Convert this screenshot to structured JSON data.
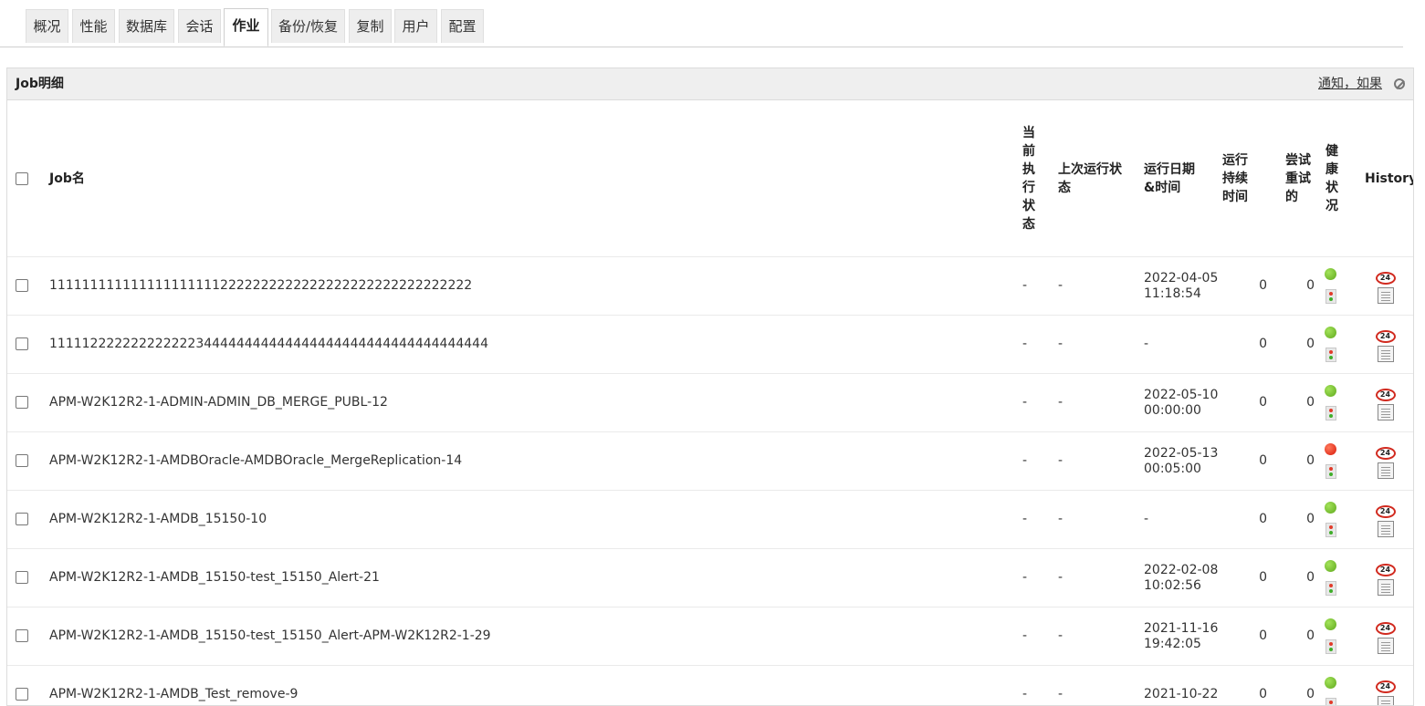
{
  "tabs": [
    {
      "label": "概况"
    },
    {
      "label": "性能"
    },
    {
      "label": "数据库"
    },
    {
      "label": "会话"
    },
    {
      "label": "作业",
      "active": true
    },
    {
      "label": "备份/恢复"
    },
    {
      "label": "复制"
    },
    {
      "label": "用户"
    },
    {
      "label": "配置"
    }
  ],
  "panel": {
    "title": "Job明细",
    "notify_link": "通知，如果",
    "hide_icon": "circle-slash-icon"
  },
  "table": {
    "headers": {
      "job_name": "Job名",
      "current_status": "当前执行状态",
      "last_run_status": "上次运行状态",
      "run_datetime": "运行日期&时间",
      "run_duration": "运行持续时间",
      "retries": "尝试重试的",
      "health": "健康状况",
      "history": "History"
    },
    "rows": [
      {
        "name": "1111111111111111111112222222222222222222222222222222",
        "current": "-",
        "last": "-",
        "date": "2022-04-05",
        "time": "11:18:54",
        "duration": "0",
        "retries": "0",
        "health": "green"
      },
      {
        "name": "111112222222222222344444444444444444444444444444444444",
        "current": "-",
        "last": "-",
        "date": "-",
        "time": "",
        "duration": "0",
        "retries": "0",
        "health": "green"
      },
      {
        "name": "APM-W2K12R2-1-ADMIN-ADMIN_DB_MERGE_PUBL-12",
        "current": "-",
        "last": "-",
        "date": "2022-05-10",
        "time": "00:00:00",
        "duration": "0",
        "retries": "0",
        "health": "green"
      },
      {
        "name": "APM-W2K12R2-1-AMDBOracle-AMDBOracle_MergeReplication-14",
        "current": "-",
        "last": "-",
        "date": "2022-05-13",
        "time": "00:05:00",
        "duration": "0",
        "retries": "0",
        "health": "red"
      },
      {
        "name": "APM-W2K12R2-1-AMDB_15150-10",
        "current": "-",
        "last": "-",
        "date": "-",
        "time": "",
        "duration": "0",
        "retries": "0",
        "health": "green"
      },
      {
        "name": "APM-W2K12R2-1-AMDB_15150-test_15150_Alert-21",
        "current": "-",
        "last": "-",
        "date": "2022-02-08",
        "time": "10:02:56",
        "duration": "0",
        "retries": "0",
        "health": "green"
      },
      {
        "name": "APM-W2K12R2-1-AMDB_15150-test_15150_Alert-APM-W2K12R2-1-29",
        "current": "-",
        "last": "-",
        "date": "2021-11-16",
        "time": "19:42:05",
        "duration": "0",
        "retries": "0",
        "health": "green"
      },
      {
        "name": "APM-W2K12R2-1-AMDB_Test_remove-9",
        "current": "-",
        "last": "-",
        "date": "2021-10-22",
        "time": "",
        "duration": "0",
        "retries": "0",
        "health": "green"
      }
    ]
  },
  "colors": {
    "health_green": "#5fa81c",
    "health_red": "#d8190a",
    "history_ring": "#d12a1f"
  },
  "icons": {
    "history_24hr": "24hr-history-icon",
    "report": "report-icon",
    "traffic_light": "traffic-light-icon",
    "health_dot": "health-status-icon"
  },
  "history_icon_text": "24"
}
